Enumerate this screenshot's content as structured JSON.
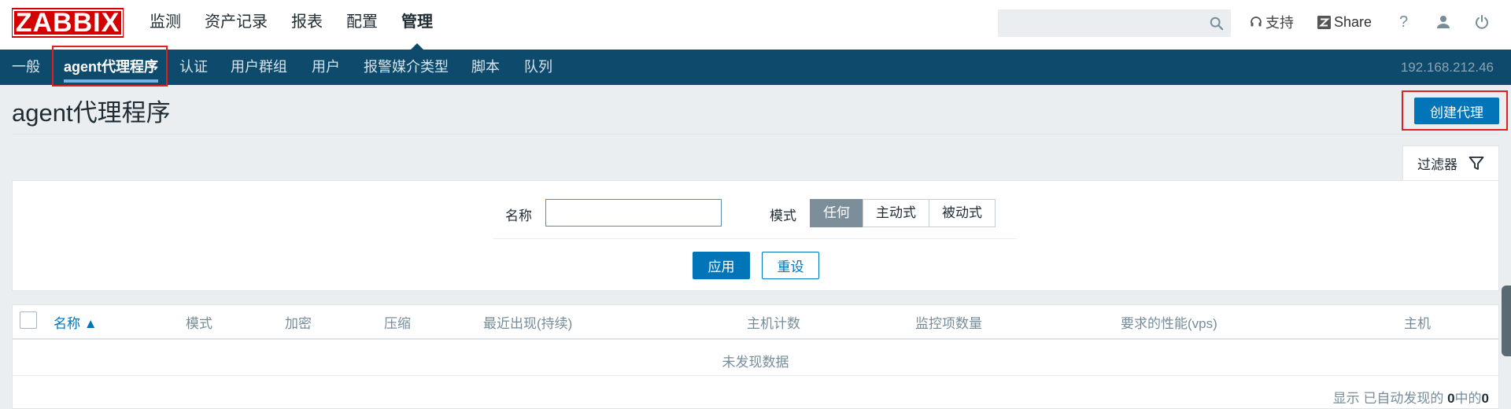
{
  "brand": {
    "logo_text": "ZABBIX",
    "color": "#d40000"
  },
  "main_menu": [
    {
      "label": "监测"
    },
    {
      "label": "资产记录"
    },
    {
      "label": "报表"
    },
    {
      "label": "配置"
    },
    {
      "label": "管理",
      "active": true
    }
  ],
  "top_right": {
    "search_placeholder": "",
    "support_label": "支持",
    "share_label": "Share",
    "help_label": "?",
    "icons": [
      "search-icon",
      "headset-icon",
      "share-z-icon",
      "help-icon",
      "user-icon",
      "power-icon"
    ]
  },
  "sub_nav": {
    "items": [
      {
        "label": "一般"
      },
      {
        "label": "agent代理程序",
        "active": true
      },
      {
        "label": "认证"
      },
      {
        "label": "用户群组"
      },
      {
        "label": "用户"
      },
      {
        "label": "报警媒介类型"
      },
      {
        "label": "脚本"
      },
      {
        "label": "队列"
      }
    ],
    "server_ip": "192.168.212.46"
  },
  "page": {
    "title": "agent代理程序",
    "create_button": "创建代理"
  },
  "filter": {
    "tab_label": "过滤器",
    "name_label": "名称",
    "name_value": "",
    "mode_label": "模式",
    "mode_options": [
      {
        "label": "任何",
        "selected": true
      },
      {
        "label": "主动式"
      },
      {
        "label": "被动式"
      }
    ],
    "apply_label": "应用",
    "reset_label": "重设"
  },
  "table": {
    "columns": [
      "名称 ▲",
      "模式",
      "加密",
      "压缩",
      "最近出现(持续)",
      "主机计数",
      "监控项数量",
      "要求的性能(vps)",
      "主机"
    ],
    "sorted_column": "名称",
    "rows": [],
    "empty_text": "未发现数据"
  },
  "footer": {
    "prefix": "显示 已自动发现的 ",
    "shown": "0",
    "middle": "中的",
    "total": "0"
  },
  "colors": {
    "nav_bg": "#0e4a6b",
    "primary": "#0275b8",
    "page_bg": "#ebeef0",
    "highlight": "#e02020"
  }
}
